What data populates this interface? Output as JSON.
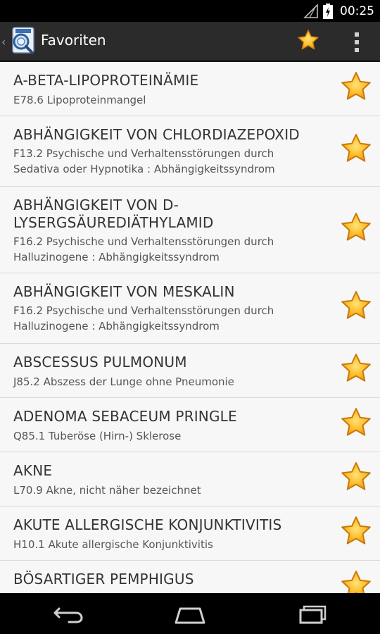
{
  "status_bar": {
    "time": "00:25"
  },
  "action_bar": {
    "title": "Favoriten",
    "star_color": "#f5a623"
  },
  "items": [
    {
      "title": "A-BETA-LIPOPROTEINÄMIE",
      "subtitle": "E78.6 Lipoproteinmangel"
    },
    {
      "title": "ABHÄNGIGKEIT VON CHLORDIAZEPOXID",
      "subtitle": "F13.2 Psychische und Verhaltensstörungen durch\nSedativa oder Hypnotika : Abhängigkeitssyndrom"
    },
    {
      "title": "ABHÄNGIGKEIT VON D-\nLYSERGSÄUREDIÄTHYLAMID",
      "subtitle": "F16.2 Psychische und Verhaltensstörungen durch\nHalluzinogene : Abhängigkeitssyndrom"
    },
    {
      "title": "ABHÄNGIGKEIT VON MESKALIN",
      "subtitle": "F16.2 Psychische und Verhaltensstörungen durch\nHalluzinogene : Abhängigkeitssyndrom"
    },
    {
      "title": "ABSCESSUS PULMONUM",
      "subtitle": "J85.2 Abszess der Lunge ohne Pneumonie"
    },
    {
      "title": "ADENOMA SEBACEUM PRINGLE",
      "subtitle": "Q85.1 Tuberöse (Hirn-) Sklerose"
    },
    {
      "title": "AKNE",
      "subtitle": "L70.9 Akne, nicht näher bezeichnet"
    },
    {
      "title": "AKUTE ALLERGISCHE KONJUNKTIVITIS",
      "subtitle": "H10.1 Akute allergische Konjunktivitis"
    },
    {
      "title": "BÖSARTIGER PEMPHIGUS",
      "subtitle": ""
    }
  ]
}
